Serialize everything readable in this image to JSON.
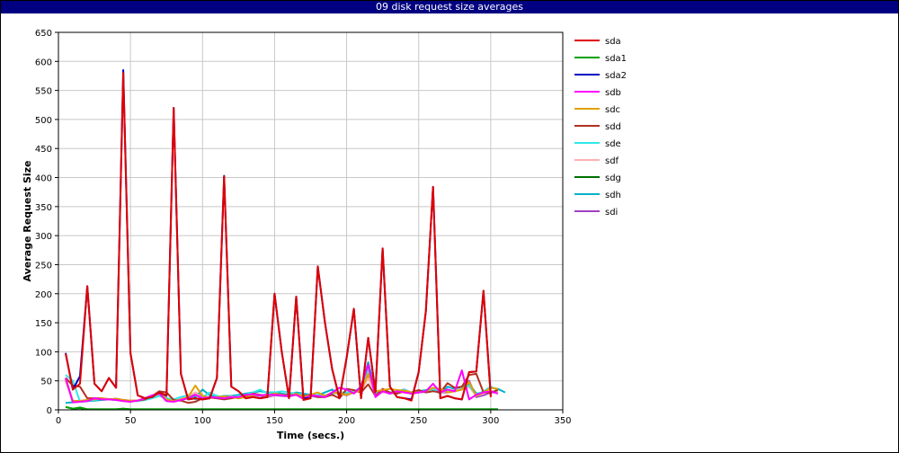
{
  "window": {
    "title": "09 disk request size averages"
  },
  "chart_data": {
    "type": "line",
    "title": "09 disk request size averages",
    "xlabel": "Time (secs.)",
    "ylabel": "Average Request Size",
    "xlim": [
      0,
      350
    ],
    "ylim": [
      0,
      650
    ],
    "xticks": [
      0,
      50,
      100,
      150,
      200,
      250,
      300,
      350
    ],
    "yticks": [
      0,
      50,
      100,
      150,
      200,
      250,
      300,
      350,
      400,
      450,
      500,
      550,
      600,
      650
    ],
    "grid": true,
    "legend_position": "right",
    "series": [
      {
        "name": "sdi",
        "color": "#a040c0",
        "x": [
          5,
          10,
          15,
          20,
          25,
          30,
          35,
          40,
          45,
          50,
          55,
          60,
          65,
          70,
          75,
          80,
          85,
          90,
          95,
          100,
          105,
          110,
          115,
          120,
          125,
          130,
          135,
          140,
          145,
          150,
          155,
          160,
          165,
          170,
          175,
          180,
          185,
          190,
          195,
          200,
          205,
          210,
          215,
          220,
          225,
          230,
          235,
          240,
          245,
          250,
          255,
          260,
          265,
          270,
          275,
          280,
          285,
          290,
          295,
          300,
          305
        ],
        "y": [
          55,
          14,
          15,
          17,
          18,
          20,
          18,
          19,
          17,
          16,
          16,
          20,
          24,
          30,
          16,
          15,
          18,
          22,
          30,
          22,
          21,
          20,
          21,
          22,
          20,
          22,
          25,
          24,
          22,
          25,
          24,
          23,
          26,
          20,
          24,
          22,
          22,
          30,
          28,
          25,
          30,
          34,
          60,
          30,
          32,
          28,
          30,
          33,
          28,
          30,
          31,
          35,
          30,
          30,
          32,
          35,
          50,
          22,
          25,
          30,
          30
        ]
      },
      {
        "name": "sdh",
        "color": "#00b0c8",
        "x": [
          5,
          10,
          15,
          20,
          25,
          30,
          35,
          40,
          45,
          50,
          55,
          60,
          65,
          70,
          75,
          80,
          85,
          90,
          95,
          100,
          105,
          110,
          115,
          120,
          125,
          130,
          135,
          140,
          145,
          150,
          155,
          160,
          165,
          170,
          175,
          180,
          185,
          190,
          195,
          200,
          205,
          210,
          215,
          220,
          225,
          230,
          235,
          240,
          245,
          250,
          255,
          260,
          265,
          270,
          275,
          280,
          285,
          290,
          295,
          300,
          305,
          310
        ],
        "y": [
          12,
          13,
          14,
          15,
          16,
          17,
          18,
          17,
          16,
          15,
          16,
          18,
          22,
          25,
          20,
          18,
          22,
          25,
          22,
          35,
          25,
          22,
          24,
          24,
          26,
          28,
          30,
          32,
          30,
          30,
          28,
          26,
          30,
          28,
          26,
          25,
          30,
          35,
          25,
          28,
          30,
          40,
          82,
          30,
          32,
          28,
          32,
          35,
          30,
          32,
          34,
          35,
          28,
          40,
          36,
          40,
          45,
          28,
          30,
          38,
          36,
          30
        ]
      },
      {
        "name": "sdg",
        "color": "#007000",
        "x": [
          5,
          10,
          15,
          20,
          40,
          45,
          50,
          300,
          305
        ],
        "y": [
          5,
          2,
          3,
          1,
          1,
          2,
          1,
          1,
          1
        ]
      },
      {
        "name": "sdf",
        "color": "#ffb0b0",
        "x": [
          5,
          10,
          15,
          20,
          25,
          30,
          35,
          40,
          45,
          50,
          55,
          60,
          65,
          70,
          75,
          80,
          85,
          90,
          95,
          100,
          105,
          110,
          115,
          120,
          125,
          130,
          135,
          140,
          145,
          150,
          155,
          160,
          165,
          170,
          175,
          180,
          185,
          190,
          195,
          200,
          205,
          210,
          215,
          220,
          225,
          230,
          235,
          240,
          245,
          250,
          255,
          260,
          265,
          270,
          275,
          280,
          285,
          290,
          295,
          300,
          305
        ],
        "y": [
          50,
          15,
          16,
          17,
          18,
          20,
          19,
          18,
          17,
          16,
          15,
          18,
          22,
          26,
          18,
          17,
          20,
          24,
          30,
          20,
          22,
          21,
          22,
          23,
          22,
          24,
          26,
          25,
          24,
          26,
          25,
          24,
          27,
          22,
          25,
          24,
          23,
          28,
          30,
          26,
          30,
          32,
          55,
          28,
          30,
          30,
          32,
          34,
          30,
          32,
          30,
          38,
          30,
          32,
          34,
          36,
          40,
          24,
          28,
          32,
          30
        ]
      },
      {
        "name": "sde",
        "color": "#30e8e8",
        "x": [
          5,
          10,
          15,
          20,
          25,
          30,
          35,
          40,
          45,
          50,
          55,
          60,
          65,
          70,
          75,
          80,
          85,
          90,
          95,
          100,
          105,
          110,
          115,
          120,
          125,
          130,
          135,
          140,
          145,
          150,
          155,
          160,
          165,
          170,
          175,
          180,
          185,
          190,
          195,
          200,
          205,
          210,
          215,
          220,
          225,
          230,
          235,
          240,
          245,
          250,
          255,
          260,
          265,
          270,
          275,
          280,
          285,
          290,
          295,
          300,
          305
        ],
        "y": [
          60,
          50,
          14,
          16,
          17,
          19,
          18,
          17,
          16,
          15,
          15,
          17,
          20,
          24,
          20,
          18,
          22,
          25,
          18,
          22,
          30,
          24,
          22,
          22,
          24,
          26,
          30,
          35,
          28,
          30,
          32,
          30,
          28,
          26,
          24,
          26,
          25,
          28,
          30,
          30,
          32,
          34,
          70,
          30,
          34,
          30,
          32,
          34,
          28,
          32,
          30,
          36,
          30,
          34,
          32,
          36,
          42,
          26,
          32,
          40,
          34
        ]
      },
      {
        "name": "sdd",
        "color": "#b03020",
        "x": [
          5,
          10,
          15,
          20,
          25,
          30,
          35,
          40,
          45,
          50,
          55,
          60,
          65,
          70,
          75,
          80,
          85,
          90,
          95,
          100,
          105,
          110,
          115,
          120,
          125,
          130,
          135,
          140,
          145,
          150,
          155,
          160,
          165,
          170,
          175,
          180,
          185,
          190,
          195,
          200,
          205,
          210,
          215,
          220,
          225,
          230,
          235,
          240,
          245,
          250,
          255,
          260,
          265,
          270,
          275,
          280,
          285,
          290,
          295,
          300,
          305
        ],
        "y": [
          55,
          42,
          40,
          20,
          20,
          20,
          18,
          19,
          17,
          15,
          16,
          18,
          24,
          32,
          30,
          17,
          16,
          12,
          14,
          20,
          22,
          20,
          18,
          20,
          22,
          24,
          28,
          26,
          24,
          28,
          26,
          25,
          26,
          24,
          26,
          22,
          22,
          26,
          20,
          36,
          34,
          30,
          44,
          24,
          36,
          30,
          28,
          32,
          30,
          34,
          30,
          32,
          30,
          46,
          38,
          40,
          60,
          62,
          30,
          30,
          34
        ]
      },
      {
        "name": "sdc",
        "color": "#e0a000",
        "x": [
          5,
          10,
          15,
          20,
          25,
          30,
          35,
          40,
          45,
          50,
          55,
          60,
          65,
          70,
          75,
          80,
          85,
          90,
          95,
          100,
          105,
          110,
          115,
          120,
          125,
          130,
          135,
          140,
          145,
          150,
          155,
          160,
          165,
          170,
          175,
          180,
          185,
          190,
          195,
          200,
          205,
          210,
          215,
          220,
          225,
          230,
          235,
          240,
          245,
          250,
          255,
          260,
          265,
          270,
          275,
          280,
          285,
          290,
          295,
          300,
          305
        ],
        "y": [
          52,
          16,
          15,
          17,
          18,
          20,
          18,
          19,
          17,
          16,
          16,
          20,
          24,
          30,
          18,
          15,
          18,
          22,
          42,
          24,
          21,
          22,
          23,
          22,
          20,
          22,
          25,
          26,
          24,
          28,
          26,
          24,
          28,
          22,
          26,
          30,
          24,
          30,
          28,
          26,
          30,
          34,
          62,
          32,
          34,
          36,
          34,
          33,
          30,
          30,
          32,
          38,
          36,
          30,
          32,
          35,
          48,
          24,
          30,
          38,
          36
        ]
      },
      {
        "name": "sdb",
        "color": "#ff00ff",
        "x": [
          5,
          10,
          15,
          20,
          25,
          30,
          35,
          40,
          45,
          50,
          55,
          60,
          65,
          70,
          75,
          80,
          85,
          90,
          95,
          100,
          105,
          110,
          115,
          120,
          125,
          130,
          135,
          140,
          145,
          150,
          155,
          160,
          165,
          170,
          175,
          180,
          185,
          190,
          195,
          200,
          205,
          210,
          215,
          220,
          225,
          230,
          235,
          240,
          245,
          250,
          255,
          260,
          265,
          270,
          275,
          280,
          285,
          290,
          295,
          300,
          305
        ],
        "y": [
          55,
          13,
          14,
          15,
          20,
          18,
          18,
          17,
          15,
          14,
          16,
          20,
          25,
          28,
          15,
          14,
          17,
          20,
          26,
          20,
          22,
          21,
          20,
          22,
          22,
          26,
          27,
          25,
          26,
          26,
          25,
          24,
          26,
          19,
          25,
          24,
          22,
          30,
          38,
          35,
          28,
          40,
          78,
          22,
          32,
          28,
          32,
          30,
          28,
          30,
          32,
          45,
          30,
          35,
          32,
          68,
          18,
          26,
          30,
          32,
          28
        ]
      },
      {
        "name": "sda2",
        "color": "#0000c0",
        "x": [
          5,
          10,
          15,
          20,
          25,
          30,
          35,
          40,
          45,
          50,
          55,
          60,
          65,
          70,
          75,
          80,
          85,
          90,
          95,
          100,
          105,
          110,
          115,
          120,
          125,
          130,
          135,
          140,
          145,
          150,
          155,
          160,
          165,
          170,
          175,
          180,
          185,
          190,
          195,
          200,
          205,
          210,
          215,
          220,
          225,
          230,
          235,
          240,
          245,
          250,
          255,
          260,
          265,
          270,
          275,
          280,
          285,
          290,
          295,
          300
        ],
        "y": [
          98,
          35,
          58,
          213,
          45,
          32,
          55,
          38,
          585,
          98,
          25,
          20,
          22,
          30,
          24,
          520,
          62,
          18,
          20,
          18,
          20,
          55,
          403,
          40,
          32,
          20,
          22,
          20,
          22,
          200,
          100,
          20,
          195,
          20,
          20,
          247,
          150,
          70,
          20,
          90,
          174,
          20,
          124,
          30,
          278,
          40,
          22,
          20,
          18,
          65,
          170,
          384,
          20,
          24,
          20,
          18,
          65,
          66,
          205,
          25
        ]
      },
      {
        "name": "sda1",
        "color": "#00a000",
        "x": [
          5,
          10,
          15,
          20,
          25,
          30,
          35,
          40,
          45,
          50,
          55,
          60,
          65,
          70,
          75,
          80,
          85,
          90,
          95,
          100,
          105,
          110,
          115,
          120,
          125,
          130,
          135,
          140,
          145,
          150,
          155,
          160,
          165,
          170,
          175,
          180,
          185,
          190,
          195,
          200,
          205,
          210,
          215,
          220,
          225,
          230,
          235,
          240,
          245,
          250,
          255,
          260,
          265,
          270,
          275,
          280,
          285,
          290,
          295,
          300,
          305
        ],
        "y": [
          5,
          2,
          4,
          1,
          1,
          1,
          1,
          1,
          2,
          1,
          1,
          1,
          1,
          1,
          1,
          1,
          1,
          1,
          1,
          1,
          1,
          1,
          1,
          1,
          1,
          1,
          1,
          1,
          1,
          1,
          1,
          1,
          1,
          1,
          1,
          1,
          1,
          1,
          1,
          1,
          1,
          1,
          1,
          1,
          1,
          1,
          1,
          1,
          1,
          1,
          1,
          1,
          1,
          1,
          1,
          1,
          1,
          1,
          1,
          1,
          1
        ]
      },
      {
        "name": "sda",
        "color": "#e00000",
        "x": [
          5,
          10,
          15,
          20,
          25,
          30,
          35,
          40,
          45,
          50,
          55,
          60,
          65,
          70,
          75,
          80,
          85,
          90,
          95,
          100,
          105,
          110,
          115,
          120,
          125,
          130,
          135,
          140,
          145,
          150,
          155,
          160,
          165,
          170,
          175,
          180,
          185,
          190,
          195,
          200,
          205,
          210,
          215,
          220,
          225,
          230,
          235,
          240,
          245,
          250,
          255,
          260,
          265,
          270,
          275,
          280,
          285,
          290,
          295,
          300
        ],
        "y": [
          97,
          35,
          45,
          213,
          45,
          32,
          55,
          38,
          580,
          98,
          25,
          20,
          22,
          30,
          25,
          520,
          62,
          18,
          20,
          18,
          20,
          55,
          402,
          40,
          32,
          20,
          22,
          20,
          22,
          200,
          100,
          20,
          195,
          17,
          20,
          247,
          150,
          70,
          20,
          90,
          174,
          20,
          124,
          30,
          278,
          40,
          22,
          20,
          16,
          65,
          170,
          384,
          20,
          24,
          20,
          18,
          65,
          66,
          205,
          22
        ]
      }
    ],
    "legend": [
      "sda",
      "sda1",
      "sda2",
      "sdb",
      "sdc",
      "sdd",
      "sde",
      "sdf",
      "sdg",
      "sdh",
      "sdi"
    ]
  }
}
